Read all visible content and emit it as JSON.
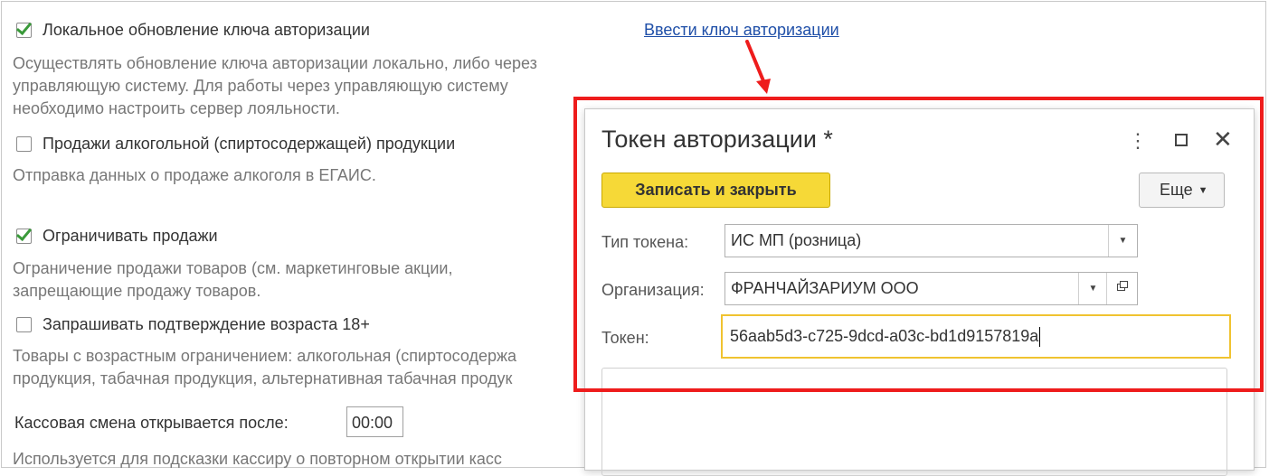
{
  "settings": {
    "local_key_update": {
      "label": "Локальное обновление ключа авторизации",
      "checked": true,
      "description": [
        "Осуществлять обновление ключа авторизации локально, либо через",
        "управляющую систему. Для работы через управляющую систему",
        "необходимо настроить сервер лояльности."
      ]
    },
    "alcohol_sales": {
      "label": "Продажи алкогольной (спиртосодержащей) продукции",
      "checked": false,
      "description": [
        "Отправка данных о продаже алкоголя в ЕГАИС."
      ]
    },
    "restrict_sales": {
      "label": "Ограничивать продажи",
      "checked": true,
      "description": [
        "Ограничение продажи товаров (см. маркетинговые акции,",
        "запрещающие продажу товаров."
      ]
    },
    "age_confirm": {
      "label": "Запрашивать подтверждение возраста 18+",
      "checked": false,
      "description": [
        "Товары с возрастным ограничением: алкогольная (спиртосодержа",
        "продукция, табачная продукция, альтернативная табачная продук"
      ]
    },
    "shift": {
      "label": "Кассовая смена открывается после:",
      "value": "00:00",
      "description": "Используется для подсказки кассиру о повторном открытии касс"
    }
  },
  "enter_key_link": "Ввести ключ авторизации",
  "dialog": {
    "title": "Токен авторизации *",
    "menu_glyph": "⋮",
    "close_glyph": "✕",
    "save_button": "Записать и закрыть",
    "more_button": "Еще",
    "token_type_label": "Тип токена:",
    "token_type_value": "ИС МП (розница)",
    "organization_label": "Организация:",
    "organization_value": "ФРАНЧАЙЗАРИУМ ООО",
    "token_label": "Токен:",
    "token_value": "56aab5d3-c725-9dcd-a03c-bd1d9157819a"
  },
  "colors": {
    "highlight": "#ee1c1c",
    "save_button": "#f6d937",
    "link": "#1f4fa8",
    "check": "#3a9a3a"
  }
}
